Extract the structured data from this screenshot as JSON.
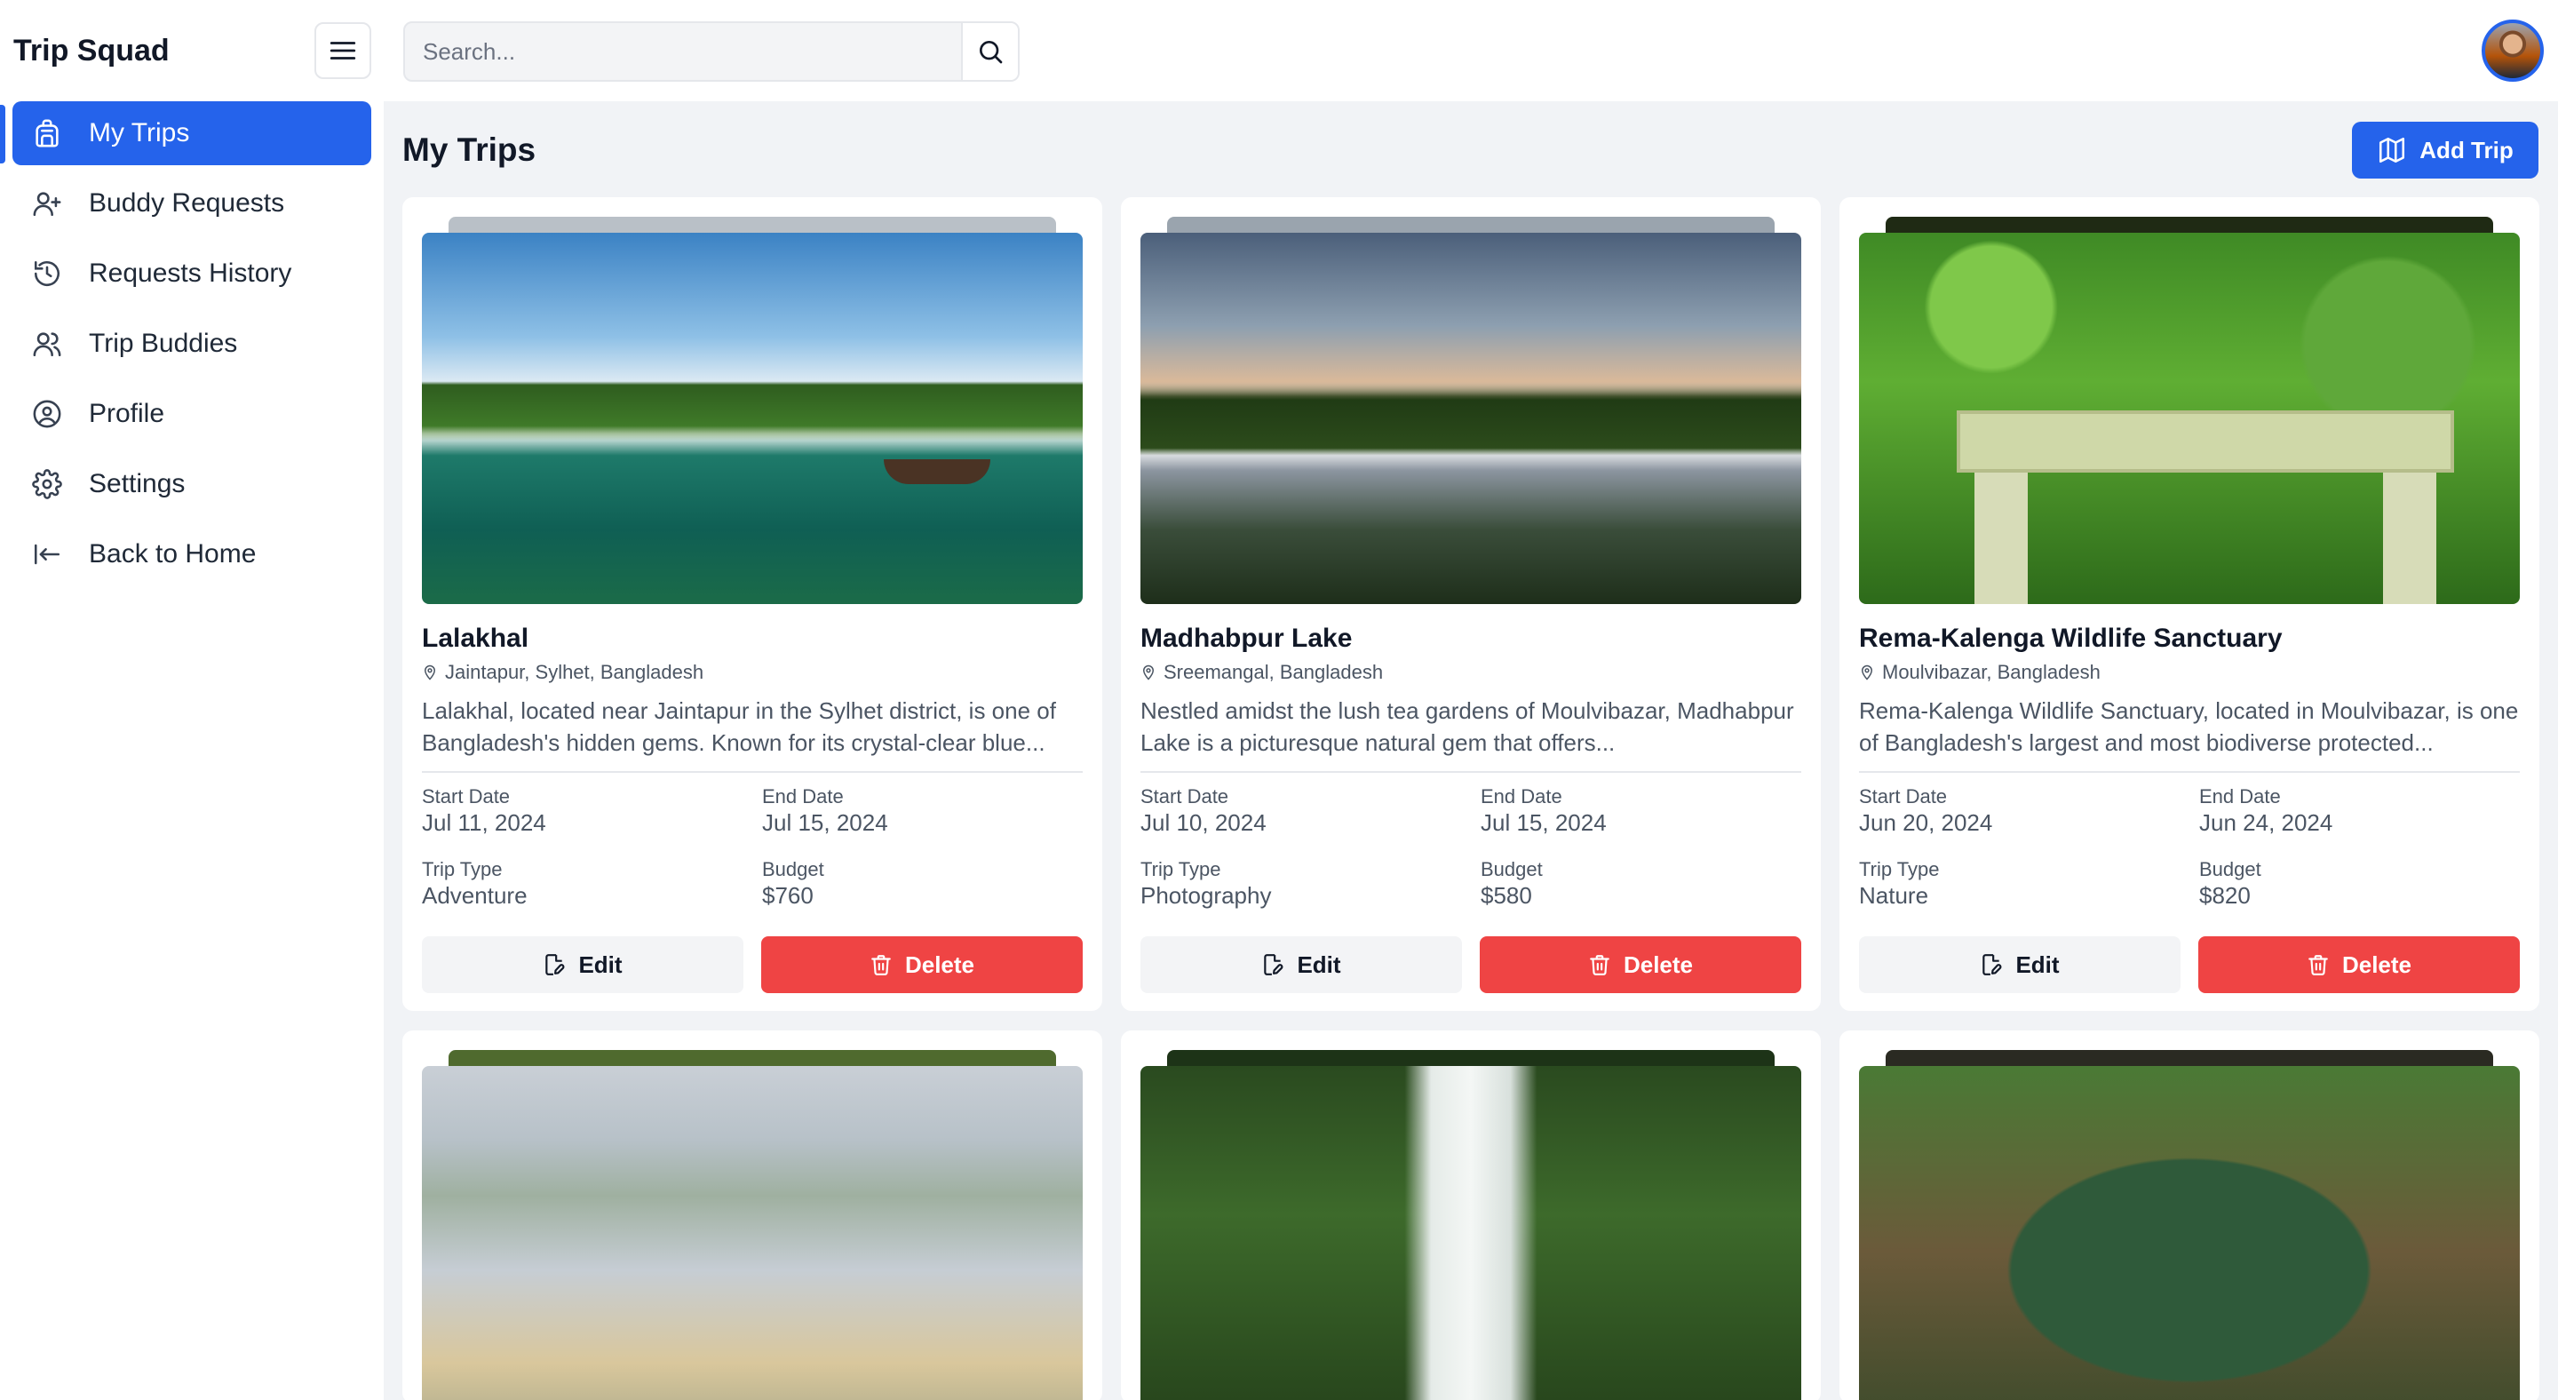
{
  "app": {
    "brand": "Trip Squad"
  },
  "sidebar": {
    "items": [
      {
        "label": "My Trips",
        "icon": "backpack-icon",
        "active": true
      },
      {
        "label": "Buddy Requests",
        "icon": "user-plus-icon"
      },
      {
        "label": "Requests History",
        "icon": "history-icon"
      },
      {
        "label": "Trip Buddies",
        "icon": "users-icon"
      },
      {
        "label": "Profile",
        "icon": "user-circle-icon"
      },
      {
        "label": "Settings",
        "icon": "gear-icon"
      },
      {
        "label": "Back to Home",
        "icon": "arrow-left-to-line-icon"
      }
    ]
  },
  "search": {
    "placeholder": "Search...",
    "value": ""
  },
  "main": {
    "title": "My Trips",
    "add_label": "Add Trip",
    "labels": {
      "start": "Start Date",
      "end": "End Date",
      "type": "Trip Type",
      "budget": "Budget",
      "edit": "Edit",
      "delete": "Delete"
    },
    "trips": [
      {
        "title": "Lalakhal",
        "location": "Jaintapur, Sylhet, Bangladesh",
        "description": "Lalakhal, located near Jaintapur in the Sylhet district, is one of Bangladesh's hidden gems. Known for its crystal-clear blue...",
        "start": "Jul 11, 2024",
        "end": "Jul 15, 2024",
        "type": "Adventure",
        "budget": "$760"
      },
      {
        "title": "Madhabpur Lake",
        "location": "Sreemangal, Bangladesh",
        "description": "Nestled amidst the lush tea gardens of Moulvibazar, Madhabpur Lake is a picturesque natural gem that offers...",
        "start": "Jul 10, 2024",
        "end": "Jul 15, 2024",
        "type": "Photography",
        "budget": "$580"
      },
      {
        "title": "Rema-Kalenga Wildlife Sanctuary",
        "location": "Moulvibazar, Bangladesh",
        "description": "Rema-Kalenga Wildlife Sanctuary, located in Moulvibazar, is one of Bangladesh's largest and most biodiverse protected...",
        "start": "Jun 20, 2024",
        "end": "Jun 24, 2024",
        "type": "Nature",
        "budget": "$820"
      }
    ]
  },
  "colors": {
    "primary": "#2563eb",
    "danger": "#ef4444"
  }
}
